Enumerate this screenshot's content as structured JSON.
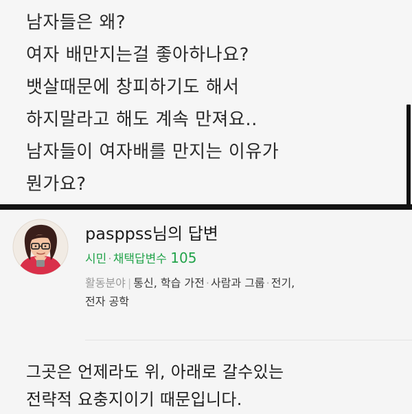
{
  "question": {
    "lines": [
      "남자들은 왜?",
      "여자 배만지는걸 좋아하나요?",
      "뱃살때문에 창피하기도 해서",
      "하지말라고 해도 계속 만져요..",
      "남자들이 여자배를 만지는 이유가",
      "뭔가요?"
    ]
  },
  "answer": {
    "author": "pasppss님의 답변",
    "rank": "시민",
    "separator": "·",
    "adopted_label": "채택답변수",
    "adopted_count": "105",
    "fields_label": "활동분야",
    "fields_bar": "|",
    "fields": [
      "통신, 학습 가전",
      "사람과 그룹",
      "전기,",
      "전자 공학"
    ],
    "body_lines": [
      "그곳은 언제라도 위, 아래로 갈수있는",
      "전략적 요충지이기 때문입니다."
    ]
  },
  "colors": {
    "accent_green": "#22a34a",
    "question_bg": "#f6f6f6",
    "divider": "#141414"
  },
  "icons": {
    "avatar": "cartoon-avatar-icon"
  }
}
